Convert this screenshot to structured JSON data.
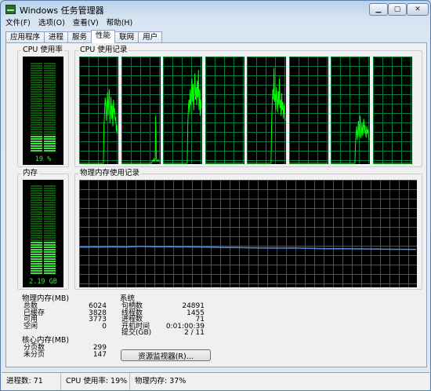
{
  "window": {
    "title": "Windows 任务管理器"
  },
  "menu": [
    "文件(F)",
    "选项(O)",
    "查看(V)",
    "帮助(H)"
  ],
  "tabs": [
    {
      "label": "应用程序",
      "active": false
    },
    {
      "label": "进程",
      "active": false
    },
    {
      "label": "服务",
      "active": false
    },
    {
      "label": "性能",
      "active": true
    },
    {
      "label": "联网",
      "active": false
    },
    {
      "label": "用户",
      "active": false
    }
  ],
  "cpu_usage": {
    "title": "CPU 使用率",
    "value_label": "19 %",
    "percent": 19
  },
  "cpu_history": {
    "title": "CPU 使用记录",
    "cores": [
      [
        0,
        0,
        0,
        0,
        0,
        0,
        0,
        0,
        0,
        0,
        0,
        0,
        0,
        0,
        0,
        0,
        0,
        0,
        0,
        0,
        0,
        0,
        0,
        0,
        0,
        0,
        0,
        0,
        0,
        0,
        0,
        0,
        0,
        0,
        0,
        0,
        0,
        0,
        0,
        0,
        0,
        0,
        35,
        48,
        62,
        55,
        40,
        52,
        67,
        45,
        58,
        70,
        38,
        50,
        63,
        42,
        55,
        35,
        60,
        48,
        52,
        40,
        44,
        30,
        36,
        28
      ],
      [
        0,
        0,
        0,
        0,
        0,
        0,
        0,
        0,
        0,
        0,
        0,
        0,
        0,
        0,
        0,
        0,
        0,
        0,
        0,
        0,
        0,
        0,
        0,
        0,
        0,
        0,
        0,
        0,
        0,
        0,
        0,
        0,
        0,
        0,
        0,
        0,
        0,
        0,
        0,
        0,
        0,
        0,
        0,
        0,
        0,
        0,
        0,
        0,
        0,
        0,
        0,
        0,
        2,
        3,
        2,
        4,
        2,
        3,
        45,
        5,
        2,
        3,
        2,
        3,
        2,
        2
      ],
      [
        0,
        0,
        0,
        0,
        0,
        0,
        0,
        0,
        0,
        0,
        0,
        0,
        0,
        0,
        0,
        0,
        0,
        0,
        0,
        0,
        0,
        0,
        0,
        0,
        0,
        0,
        0,
        0,
        0,
        0,
        0,
        0,
        0,
        0,
        0,
        0,
        0,
        0,
        0,
        0,
        0,
        0,
        38,
        52,
        60,
        48,
        70,
        55,
        62,
        80,
        58,
        75,
        50,
        68,
        85,
        60,
        72,
        55,
        78,
        62,
        88,
        50,
        70,
        45,
        60,
        52
      ],
      [
        0,
        0,
        0,
        0,
        0,
        0,
        0,
        0,
        0,
        0,
        0,
        0,
        0,
        0,
        0,
        0,
        0,
        0,
        0,
        0,
        0,
        0,
        0,
        0,
        0,
        0,
        0,
        0,
        0,
        0,
        0,
        0,
        0,
        0,
        0,
        0,
        0,
        0,
        0,
        0,
        0,
        0,
        0,
        0,
        0,
        0,
        0,
        0,
        0,
        0,
        0,
        0,
        0,
        0,
        0,
        0,
        0,
        0,
        0,
        0,
        0,
        0,
        0,
        0,
        0,
        0
      ],
      [
        0,
        0,
        0,
        0,
        0,
        0,
        0,
        0,
        0,
        0,
        0,
        0,
        0,
        0,
        0,
        0,
        0,
        0,
        0,
        0,
        0,
        0,
        0,
        0,
        0,
        0,
        0,
        0,
        0,
        0,
        0,
        0,
        0,
        0,
        0,
        0,
        0,
        0,
        0,
        0,
        0,
        0,
        42,
        55,
        70,
        60,
        90,
        58,
        65,
        50,
        72,
        62,
        48,
        68,
        55,
        80,
        52,
        60,
        45,
        66,
        50,
        58,
        42,
        55,
        48,
        40
      ],
      [
        0,
        0,
        0,
        0,
        0,
        0,
        0,
        0,
        0,
        0,
        0,
        0,
        0,
        0,
        0,
        0,
        0,
        0,
        0,
        0,
        0,
        0,
        0,
        0,
        0,
        0,
        0,
        0,
        0,
        0,
        0,
        0,
        0,
        0,
        0,
        0,
        0,
        0,
        0,
        0,
        0,
        0,
        0,
        0,
        0,
        0,
        0,
        0,
        0,
        0,
        0,
        0,
        0,
        0,
        0,
        0,
        0,
        0,
        0,
        0,
        0,
        0,
        0,
        0,
        0,
        0
      ],
      [
        0,
        0,
        0,
        0,
        0,
        0,
        0,
        0,
        0,
        0,
        0,
        0,
        0,
        0,
        0,
        0,
        0,
        0,
        0,
        0,
        0,
        0,
        0,
        0,
        0,
        0,
        0,
        0,
        0,
        0,
        0,
        0,
        0,
        0,
        0,
        0,
        0,
        0,
        0,
        0,
        0,
        0,
        20,
        28,
        35,
        22,
        30,
        40,
        25,
        32,
        45,
        24,
        30,
        38,
        26,
        34,
        42,
        28,
        36,
        30,
        24,
        35,
        28,
        32,
        26,
        22
      ],
      [
        0,
        0,
        0,
        0,
        0,
        0,
        0,
        0,
        0,
        0,
        0,
        0,
        0,
        0,
        0,
        0,
        0,
        0,
        0,
        0,
        0,
        0,
        0,
        0,
        0,
        0,
        0,
        0,
        0,
        0,
        0,
        0,
        0,
        0,
        0,
        0,
        0,
        0,
        0,
        0,
        0,
        0,
        0,
        0,
        0,
        0,
        0,
        0,
        0,
        0,
        0,
        0,
        0,
        0,
        0,
        0,
        0,
        0,
        0,
        0,
        0,
        0,
        0,
        0,
        0,
        0
      ]
    ]
  },
  "memory": {
    "title": "内存",
    "value_label": "2.19 GB",
    "percent": 37
  },
  "memory_history": {
    "title": "物理内存使用记录",
    "percent_series": [
      37.5,
      37.4,
      37.6,
      37.5,
      37.7,
      37.6,
      37.5,
      37.8,
      38.2,
      37.9,
      37.8,
      37.7,
      37.8,
      37.6,
      37.7,
      37.6,
      37.5,
      37.4,
      37.2,
      37.1,
      37.0,
      36.9,
      36.8,
      36.7,
      36.6,
      36.6,
      36.5,
      36.5,
      36.6,
      36.4,
      36.3,
      36.1,
      36.0,
      36.0,
      35.9,
      35.9,
      35.8,
      35.8,
      35.7,
      35.6,
      35.5,
      35.4,
      35.4,
      35.3,
      35.3
    ]
  },
  "physical_memory": {
    "title": "物理内存(MB)",
    "rows": [
      {
        "label": "总数",
        "value": "6024"
      },
      {
        "label": "已缓存",
        "value": "3828"
      },
      {
        "label": "可用",
        "value": "3773"
      },
      {
        "label": "空闲",
        "value": "0"
      }
    ]
  },
  "kernel_memory": {
    "title": "核心内存(MB)",
    "rows": [
      {
        "label": "分页数",
        "value": "299"
      },
      {
        "label": "未分页",
        "value": "147"
      }
    ]
  },
  "system": {
    "title": "系统",
    "rows": [
      {
        "label": "句柄数",
        "value": "24891"
      },
      {
        "label": "线程数",
        "value": "1455"
      },
      {
        "label": "进程数",
        "value": "71"
      },
      {
        "label": "开机时间",
        "value": "0:01:00:39"
      },
      {
        "label": "提交(GB)",
        "value": "2 / 11"
      }
    ]
  },
  "resource_monitor_label": "资源监视器(R)...",
  "statusbar": {
    "processes": "进程数: 71",
    "cpu": "CPU 使用率: 19%",
    "memory": "物理内存: 37%"
  },
  "colors": {
    "graph_bg": "#000000",
    "grid": "#008040",
    "cpu_line": "#00ff00",
    "memory_line": "#4a8fe0",
    "meter_on": "#3fe03f",
    "meter_off": "#0a5a0a"
  }
}
